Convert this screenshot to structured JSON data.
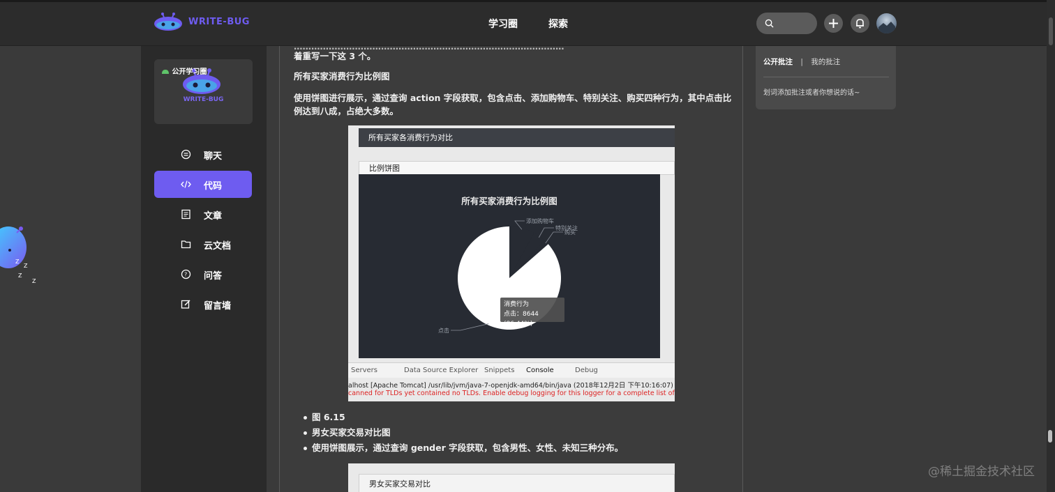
{
  "header": {
    "logo_text": "WRITE-BUG",
    "nav": [
      "学习圈",
      "探索"
    ],
    "icons": [
      "search-icon",
      "plus-icon",
      "bell-icon",
      "avatar"
    ],
    "brand_color": "#6e5cf0"
  },
  "sidebar": {
    "circle_card": {
      "tag": "公开学习圈",
      "logo_text": "WRITE-BUG"
    },
    "items": [
      {
        "label": "聊天",
        "icon": "chat-icon",
        "active": false
      },
      {
        "label": "代码",
        "icon": "code-icon",
        "active": true
      },
      {
        "label": "文章",
        "icon": "article-icon",
        "active": false
      },
      {
        "label": "云文档",
        "icon": "folder-icon",
        "active": false
      },
      {
        "label": "问答",
        "icon": "question-icon",
        "active": false
      },
      {
        "label": "留言墙",
        "icon": "edit-icon",
        "active": false
      }
    ]
  },
  "main": {
    "intro_tail": "着重写一下这 3 个。",
    "heading1": "所有买家消费行为比例图",
    "desc1_line1": "使用饼图进行展示，通过查询 action 字段获取，包含点击、添加购物车、特别关注、购买四种行为，其中点击比",
    "desc1_line2": "例达到八成，占绝大多数。",
    "figure1": {
      "window_title": "所有买家各消费行为对比",
      "panel_title": "比例饼图",
      "console_tabs": [
        "Servers",
        "Data Source Explorer",
        "Snippets",
        "Console",
        "Debug"
      ],
      "console_line1": "alhost [Apache Tomcat] /usr/lib/jvm/java-7-openjdk-amd64/bin/java (2018年12月2日 下午10:16:07)",
      "console_line2": "canned for TLDs yet contained no TLDs. Enable debug logging for this logger for a complete list of JARs that were scanned"
    },
    "bullets": [
      "图 6.15",
      "男女买家交易对比图",
      "使用饼图展示，通过查询 gender 字段获取，包含男性、女性、未知三种分布。"
    ],
    "figure2": {
      "window_title": "男女买家交易对比"
    }
  },
  "chart_data": {
    "type": "pie",
    "title": "所有买家消费行为比例图",
    "series_name": "消费行为",
    "categories": [
      "点击",
      "添加购物车",
      "特别关注",
      "购买"
    ],
    "values": [
      8644,
      800,
      400,
      157
    ],
    "tooltip": {
      "line1": "消费行为",
      "line2": "点击：8644 (86.44%)"
    },
    "colors": {
      "click": "#ffffff",
      "cart": "#272b33",
      "follow": "#272b33",
      "buy": "#272b33"
    }
  },
  "annotations": {
    "tab_public": "公开批注",
    "separator": "|",
    "tab_mine": "我的批注",
    "hint": "划词添加批注或者你想说的话~"
  },
  "watermark": "@稀土掘金技术社区"
}
